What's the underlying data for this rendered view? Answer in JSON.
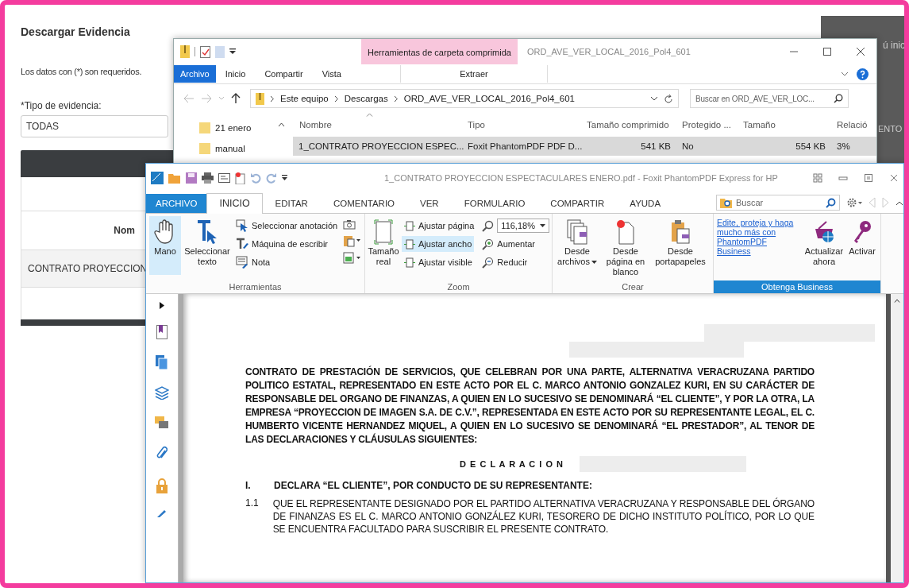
{
  "web_page": {
    "title": "Descargar Evidencia",
    "required_note": "Los datos con (*) son requeridos.",
    "evidence_type": {
      "label": "*Tipo de evidencia:",
      "value": "TODAS"
    },
    "table": {
      "column_header": "Nom",
      "rows": [
        {
          "cell": "CONTRATO PROYECCION"
        }
      ]
    },
    "side_panel": {
      "text_1": "ú inic",
      "text_2": "ENTO"
    }
  },
  "explorer": {
    "context_tab": "Herramientas de carpeta comprimida",
    "title": "ORD_AVE_VER_LOCAL_2016_Pol4_601",
    "tabs": [
      {
        "label": "Archivo",
        "kind": "file"
      },
      {
        "label": "Inicio",
        "kind": "tab"
      },
      {
        "label": "Compartir",
        "kind": "tab"
      },
      {
        "label": "Vista",
        "kind": "tab"
      }
    ],
    "context_subtab": "Extraer",
    "breadcrumbs": [
      "Este equipo",
      "Descargas",
      "ORD_AVE_VER_LOCAL_2016_Pol4_601"
    ],
    "search": {
      "placeholder": "Buscar en ORD_AVE_VER_LOC..."
    },
    "nav_folders": [
      "21 enero",
      "manual"
    ],
    "columns": [
      "Nombre",
      "Tipo",
      "Tamaño comprimido",
      "Protegido ...",
      "Tamaño",
      "Relació"
    ],
    "files": [
      {
        "name": "1_CONTRATO PROYECCION ESPEC...",
        "type": "Foxit PhantomPDF PDF D...",
        "compressed_size": "541 KB",
        "protected": "No",
        "size": "554 KB",
        "ratio": "3%",
        "selected": true
      }
    ]
  },
  "pdf_viewer": {
    "title": "1_CONTRATO PROYECCION ESPECTACULARES ENERO.pdf - Foxit PhantomPDF Express for HP",
    "tabs": [
      {
        "label": "ARCHIVO",
        "kind": "file",
        "selected": false
      },
      {
        "label": "INICIO",
        "kind": "tab",
        "selected": true
      },
      {
        "label": "EDITAR",
        "kind": "tab",
        "selected": false
      },
      {
        "label": "COMENTARIO",
        "kind": "tab",
        "selected": false
      },
      {
        "label": "VER",
        "kind": "tab",
        "selected": false
      },
      {
        "label": "FORMULARIO",
        "kind": "tab",
        "selected": false
      },
      {
        "label": "COMPARTIR",
        "kind": "tab",
        "selected": false
      },
      {
        "label": "AYUDA",
        "kind": "tab",
        "selected": false
      }
    ],
    "search": {
      "placeholder": "Buscar"
    },
    "tools": {
      "label": "Herramientas",
      "large": [
        {
          "label": "Mano",
          "selected": true
        },
        {
          "label": "Seleccionar texto",
          "selected": false
        }
      ],
      "small": [
        {
          "label": "Seleccionar anotación",
          "selected": false
        },
        {
          "label": "Máquina de escribir",
          "selected": false
        },
        {
          "label": "Nota",
          "selected": false
        }
      ]
    },
    "zoom": {
      "label": "Zoom",
      "actual_size": "Tamaño real",
      "fit": [
        {
          "label": "Ajustar página",
          "selected": false
        },
        {
          "label": "Ajustar ancho",
          "selected": true
        },
        {
          "label": "Ajustar visible",
          "selected": false
        }
      ],
      "value": "116,18%",
      "zoom_in": "Aumentar",
      "zoom_out": "Reducir"
    },
    "create": {
      "label": "Crear",
      "items": [
        "Desde archivos",
        "Desde página en blanco",
        "Desde portapapeles"
      ]
    },
    "business": {
      "label": "Obtenga Business",
      "link": "Edite, proteja y haga mucho más con PhantomPDF Business",
      "upgrade": "Actualizar ahora",
      "activate": "Activar"
    },
    "document": {
      "intro": "CONTRATO DE PRESTACIÓN DE SERVICIOS, QUE CELEBRAN POR UNA PARTE, ALTERNATIVA VERACRUZANA PARTIDO POLITICO ESTATAL, REPRESENTADO EN ESTE ACTO POR EL C. MARCO ANTONIO GONZALEZ KURI, EN SU CARÁCTER DE RESPONSABLE DEL ORGANO DE FINANZAS, A QUIEN EN LO SUCESIVO SE DENOMINARÁ “EL CLIENTE”, Y POR LA OTRA, LA EMPRESA “PROYECCION DE IMAGEN S.A. DE C.V.”, REPRESENTADA EN ESTE ACTO POR SU REPRESENTANTE LEGAL, EL C. HUMBERTO VICENTE HERNANDEZ MIQUEL, A QUIEN EN LO SUCESIVO SE DENOMINARÁ “EL PRESTADOR”, AL TENOR DE LAS DECLARACIONES Y CLÁUSULAS SIGUIENTES:",
      "heading": "D E C L A R A C I O N",
      "section": {
        "number": "I.",
        "text": "DECLARA “EL CLIENTE”, POR CONDUCTO DE SU REPRESENTANTE:"
      },
      "clauses": [
        {
          "number": "1.1",
          "text": "QUE EL REPRESENTANTE DESIGNADO POR EL PARTIDO ALTERNATIVA VERACRUZANA Y RESPONSABLE DEL ÓRGANO DE FINANZAS ES EL C. MARCO ANTONIO GONZÁLEZ KURI, TESORERO DE DICHO INSTITUTO POLÍTICO, POR LO QUE SE ENCUENTRA FACULTADO PARA SUSCRIBIR EL PRESENTE CONTRATO."
        }
      ]
    }
  }
}
